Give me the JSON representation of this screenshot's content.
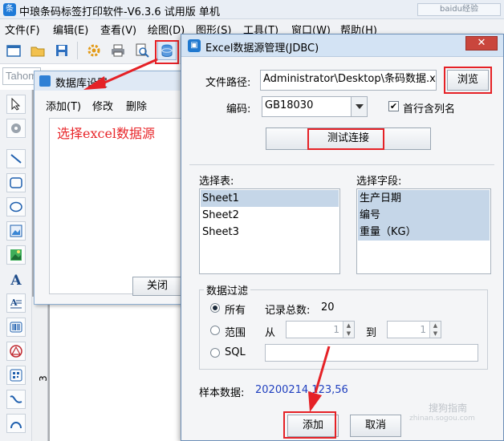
{
  "app": {
    "title": "中琅条码标签打印软件-V6.3.6 试用版 单机",
    "logo": "条",
    "topright": "baidu经验"
  },
  "menu": [
    "文件(F)",
    "编辑(E)",
    "查看(V)",
    "绘图(D)",
    "图形(S)",
    "工具(T)",
    "窗口(W)",
    "帮助(H)"
  ],
  "toolbar_icons": [
    "new-icon",
    "open-icon",
    "save-icon",
    "settings-gear-icon",
    "print-icon",
    "print-preview-icon",
    "database-icon"
  ],
  "font_field": "Tahoma",
  "left_tools": [
    "pointer-icon",
    "rotate-icon",
    "line-icon",
    "rounded-rect-icon",
    "ellipse-icon",
    "image-icon",
    "picture-icon",
    "text-icon",
    "paragraph-icon",
    "barcode-icon",
    "qrcode-triangle-icon",
    "qrcode-icon",
    "curve-icon",
    "arc-icon"
  ],
  "ruler_number": "3",
  "db_dialog": {
    "title": "数据库设置",
    "menu": [
      "添加(T)",
      "修改",
      "删除"
    ],
    "annotation": "选择excel数据源",
    "close_label": "关闭"
  },
  "jdbc": {
    "title": "Excel数据源管理(JDBC)",
    "close_symbol": "✕",
    "path_label": "文件路径:",
    "path_value": "Administrator\\Desktop\\条码数据.xls",
    "browse_label": "浏览",
    "encoding_label": "编码:",
    "encoding_value": "GB18030",
    "header_checkbox_label": "首行含列名",
    "header_checked": true,
    "test_label": "测试连接",
    "table_label": "选择表:",
    "tables": [
      "Sheet1",
      "Sheet2",
      "Sheet3"
    ],
    "selected_table": "Sheet1",
    "field_label": "选择字段:",
    "fields": [
      "生产日期",
      "编号",
      "重量（KG）"
    ],
    "filter_group": "数据过滤",
    "all_label": "所有",
    "count_label": "记录总数:",
    "count_value": "20",
    "range_label": "范围",
    "from_label": "从",
    "from_value": "1",
    "to_label": "到",
    "to_value": "1",
    "sql_label": "SQL",
    "selected_filter": "all",
    "sample_label": "样本数据:",
    "sample_value": "20200214,123,56",
    "add_label": "添加",
    "cancel_label": "取消"
  },
  "watermark": {
    "text": "搜狗指南",
    "sub": "zhinan.sogou.com"
  },
  "colors": {
    "annotation": "#e52126",
    "sample": "#1f3fbf",
    "selection": "#c5d6e8"
  }
}
